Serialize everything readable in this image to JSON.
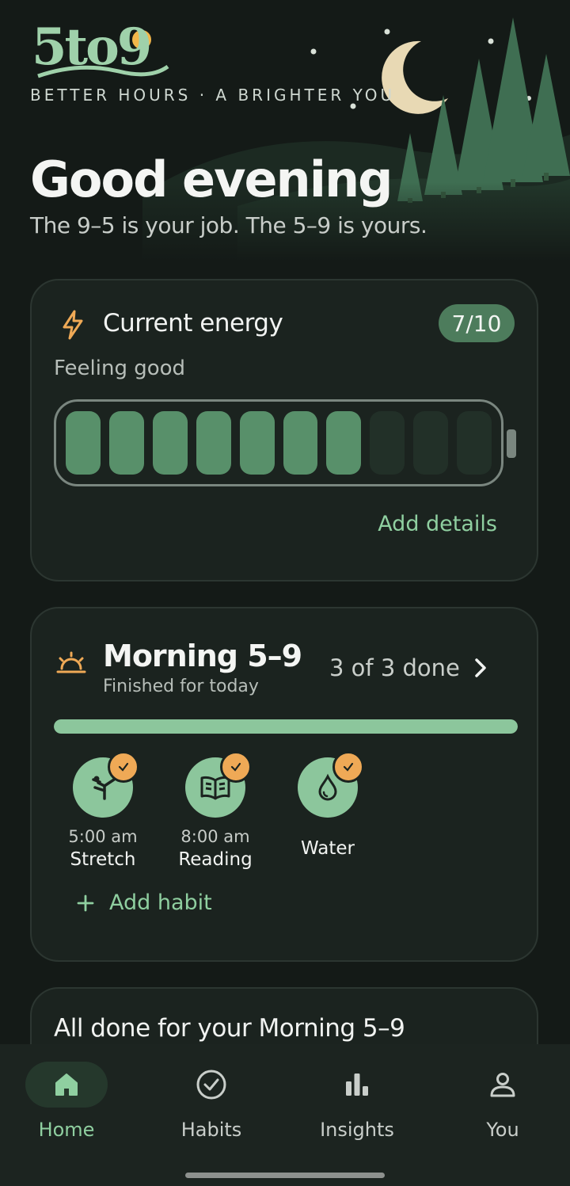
{
  "app": {
    "logo_text": "5to9",
    "tagline": "BETTER HOURS · A BRIGHTER YOU"
  },
  "header": {
    "greeting": "Good evening",
    "subtitle": "The 9–5 is your job. The 5–9 is yours."
  },
  "energy": {
    "title": "Current energy",
    "score": "7/10",
    "level": 7,
    "max": 10,
    "status": "Feeling good",
    "add_details": "Add details",
    "icon": "lightning-icon"
  },
  "morning": {
    "title": "Morning 5–9",
    "subtitle": "Finished for today",
    "count": "3 of 3 done",
    "progress": 1.0,
    "icon": "sunrise-icon",
    "habits": [
      {
        "time": "5:00 am",
        "name": "Stretch",
        "icon": "stretch-icon",
        "done": true
      },
      {
        "time": "8:00 am",
        "name": "Reading",
        "icon": "book-icon",
        "done": true
      },
      {
        "time": "",
        "name": "Water",
        "icon": "water-drop-icon",
        "done": true
      }
    ],
    "add_habit": "Add habit"
  },
  "summary": {
    "title": "All done for your Morning 5–9"
  },
  "nav": {
    "items": [
      {
        "label": "Home",
        "icon": "home-icon",
        "active": true
      },
      {
        "label": "Habits",
        "icon": "check-circle-icon",
        "active": false
      },
      {
        "label": "Insights",
        "icon": "bar-chart-icon",
        "active": false
      },
      {
        "label": "You",
        "icon": "person-icon",
        "active": false
      }
    ]
  },
  "colors": {
    "background": "#141a17",
    "card": "#1b231f",
    "accent_green": "#8cc69c",
    "accent_orange": "#efa956",
    "forest": "#3f6e52"
  }
}
